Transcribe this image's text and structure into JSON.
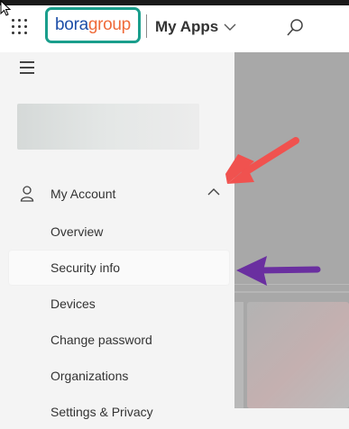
{
  "header": {
    "logo_part1": "bora",
    "logo_part2": "group",
    "apps_label": "My Apps"
  },
  "nav": {
    "section_label": "My Account",
    "items": [
      {
        "label": "Overview"
      },
      {
        "label": "Security info"
      },
      {
        "label": "Devices"
      },
      {
        "label": "Change password"
      },
      {
        "label": "Organizations"
      },
      {
        "label": "Settings & Privacy"
      }
    ]
  },
  "colors": {
    "logo_border": "#1a9e8c",
    "logo_bora": "#1d4ea8",
    "logo_group": "#ef6b3a",
    "red_arrow": "#f0524f",
    "purple_arrow": "#6a2fa0"
  },
  "icons": {
    "waffle": "waffle-icon",
    "search": "search-icon",
    "hamburger": "hamburger-icon",
    "person": "person-icon"
  }
}
